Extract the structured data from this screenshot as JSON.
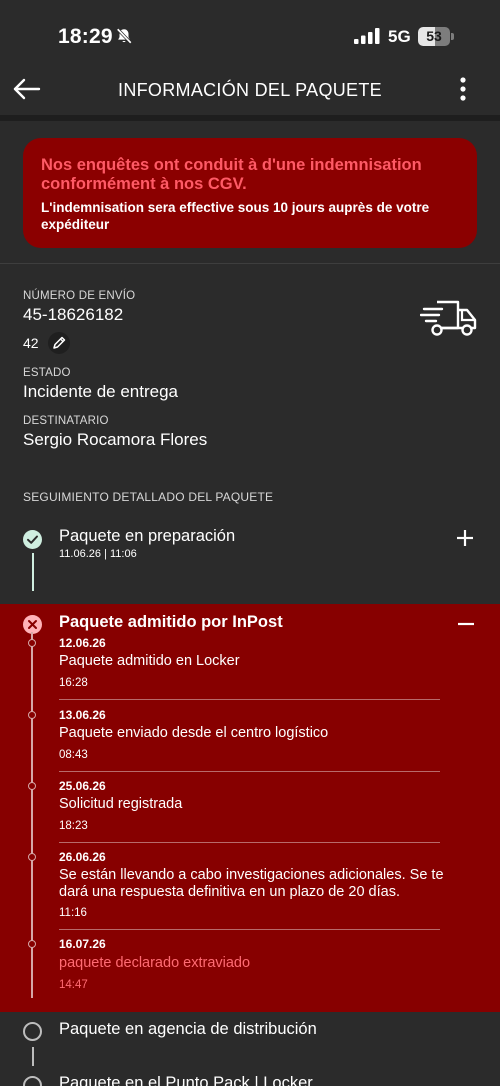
{
  "status_bar": {
    "time": "18:29",
    "network": "5G",
    "battery": "53",
    "battery_level": 0.53
  },
  "header": {
    "title": "INFORMACIÓN DEL PAQUETE"
  },
  "alert": {
    "title": "Nos enquêtes ont conduit à d'une indemnisation conformément à nos CGV.",
    "body": "L'indemnisation sera effective sous 10 jours auprès de votre expéditeur"
  },
  "shipment": {
    "number_label": "NÚMERO DE ENVÍO",
    "number": "45-18626182",
    "pieces": "42",
    "status_label": "ESTADO",
    "status": "Incidente de entrega",
    "recipient_label": "DESTINATARIO",
    "recipient": "Sergio Rocamora Flores"
  },
  "tracking": {
    "section_title": "SEGUIMIENTO DETALLADO DEL PAQUETE",
    "steps": [
      {
        "title": "Paquete en preparación",
        "date": "11.06.26 | 11:06",
        "state": "done"
      },
      {
        "title": "Paquete admitido por InPost",
        "state": "error",
        "events": [
          {
            "date": "12.06.26",
            "desc": "Paquete admitido en Locker",
            "time": "16:28"
          },
          {
            "date": "13.06.26",
            "desc": "Paquete enviado desde el centro logístico",
            "time": "08:43"
          },
          {
            "date": "25.06.26",
            "desc": "Solicitud registrada",
            "time": "18:23"
          },
          {
            "date": "26.06.26",
            "desc": "Se están llevando a cabo investigaciones adicionales. Se te dará una respuesta definitiva en un plazo de 20 días.",
            "time": "11:16"
          },
          {
            "date": "16.07.26",
            "desc": "paquete declarado extraviado",
            "time": "14:47"
          }
        ]
      },
      {
        "title": "Paquete en agencia de distribución",
        "state": "pending"
      },
      {
        "title": "Paquete en el Punto Pack | Locker",
        "state": "pending"
      }
    ]
  },
  "colors": {
    "background": "#2b2b2b",
    "alert_bg": "#8b0000",
    "alert_title": "#ff5a66",
    "expanded_bg": "#870000",
    "success": "#cfeee0"
  },
  "icons": [
    "bell-slash-icon",
    "signal-icon",
    "back-arrow-icon",
    "more-vertical-icon",
    "truck-icon",
    "pencil-icon",
    "check-circle-icon",
    "x-circle-icon",
    "plus-icon",
    "minus-icon"
  ]
}
